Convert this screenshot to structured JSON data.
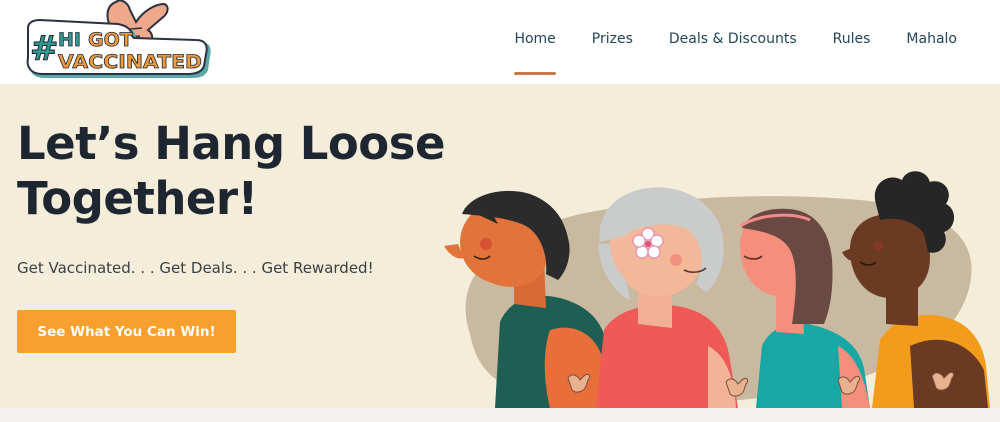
{
  "logo": {
    "hash": "#",
    "hi": "HI",
    "got": "GOT",
    "vaccinated": "VACCINATED"
  },
  "nav": {
    "items": [
      {
        "label": "Home",
        "active": true
      },
      {
        "label": "Prizes",
        "active": false
      },
      {
        "label": "Deals & Discounts",
        "active": false
      },
      {
        "label": "Rules",
        "active": false
      },
      {
        "label": "Mahalo",
        "active": false
      }
    ]
  },
  "hero": {
    "title_line1": "Let’s Hang Loose",
    "title_line2": "Together!",
    "subtitle": "Get Vaccinated. . . Get Deals. . . Get Rewarded!",
    "cta_label": "See What You Can Win!"
  },
  "colors": {
    "hero_bg": "#f4edd9",
    "cta": "#f7a030",
    "nav_text": "#23465a",
    "nav_active_underline": "#c7794a",
    "logo_teal": "#2f9a93",
    "logo_orange": "#f19a3e"
  }
}
